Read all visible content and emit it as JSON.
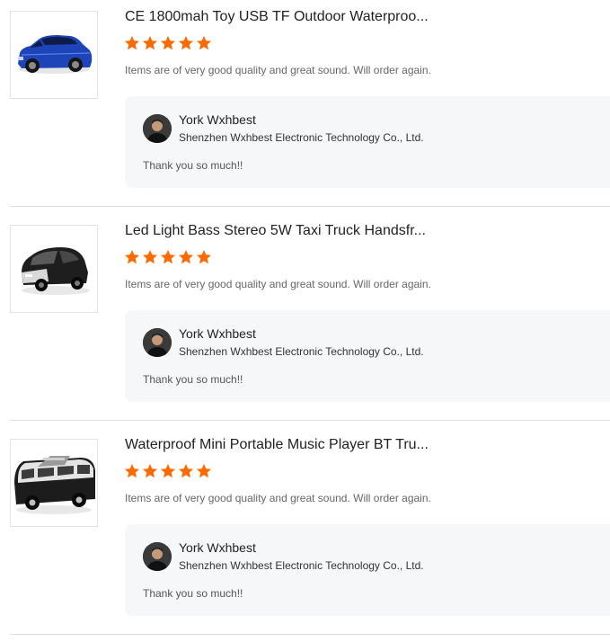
{
  "reviews": [
    {
      "product_title": "CE 1800mah Toy USB TF Outdoor Waterproo...",
      "product_image": "blue-suv-speaker",
      "rating": 5,
      "rating_max": 5,
      "comment": "Items are of very good quality and great sound. Will order again.",
      "reply": {
        "seller_name": "York Wxhbest",
        "company": "Shenzhen Wxhbest Electronic Technology Co., Ltd.",
        "text": "Thank you so much!!"
      }
    },
    {
      "product_title": "Led Light Bass Stereo 5W Taxi Truck Handsfr...",
      "product_image": "black-mini-car-speaker",
      "rating": 5,
      "rating_max": 5,
      "comment": "Items are of very good quality and great sound. Will order again.",
      "reply": {
        "seller_name": "York Wxhbest",
        "company": "Shenzhen Wxhbest Electronic Technology Co., Ltd.",
        "text": "Thank you so much!!"
      }
    },
    {
      "product_title": "Waterproof Mini Portable Music Player BT Tru...",
      "product_image": "black-van-bus-speaker",
      "rating": 5,
      "rating_max": 5,
      "comment": "Items are of very good quality and great sound. Will order again.",
      "reply": {
        "seller_name": "York Wxhbest",
        "company": "Shenzhen Wxhbest Electronic Technology Co., Ltd.",
        "text": "Thank you so much!!"
      }
    }
  ],
  "colors": {
    "star": "#ff6a00",
    "reply_background": "#f6f7f9",
    "divider": "#dddddd"
  }
}
